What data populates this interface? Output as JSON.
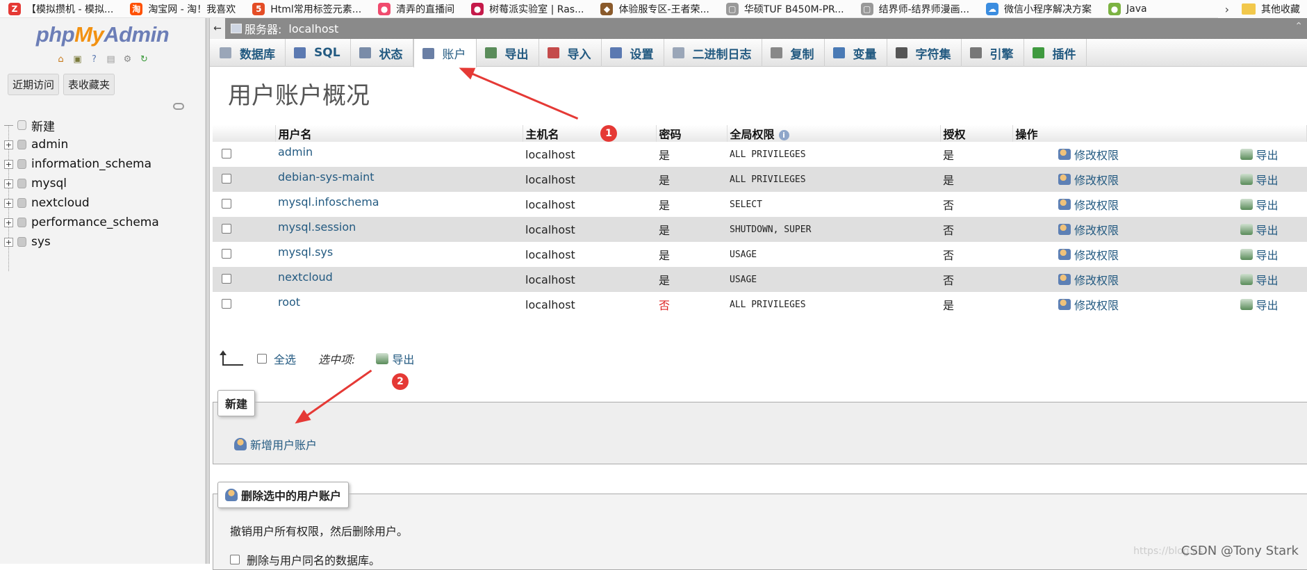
{
  "bookmarks": [
    {
      "label": "【模拟攒机 - 模拟...",
      "icon": "zol-icon",
      "color": "#e53935",
      "glyph": "Z"
    },
    {
      "label": "淘宝网 - 淘！我喜欢",
      "icon": "taobao-icon",
      "color": "#ff5000",
      "glyph": "淘"
    },
    {
      "label": "Html常用标签元素...",
      "icon": "html5-icon",
      "color": "#e44d26",
      "glyph": "5"
    },
    {
      "label": "清弄的直播间",
      "icon": "live-icon",
      "color": "#f04b6e",
      "glyph": "●"
    },
    {
      "label": "树莓派实验室 | Ras...",
      "icon": "raspberry-icon",
      "color": "#c51a4a",
      "glyph": "●"
    },
    {
      "label": "体验服专区-王者荣...",
      "icon": "game-icon",
      "color": "#8a5a2b",
      "glyph": "◆"
    },
    {
      "label": "华硕TUF B450M-PR...",
      "icon": "page-icon",
      "color": "#999999",
      "glyph": "▢"
    },
    {
      "label": "结界师-结界师漫画...",
      "icon": "page-icon",
      "color": "#999999",
      "glyph": "▢"
    },
    {
      "label": "微信小程序解决方案",
      "icon": "cloud-icon",
      "color": "#3b8de0",
      "glyph": "☁"
    },
    {
      "label": "Java",
      "icon": "java-icon",
      "color": "#7cb342",
      "glyph": "●"
    }
  ],
  "bookmarks_more": "其他收藏",
  "logo": {
    "php": "php",
    "my": "My",
    "admin": "Admin"
  },
  "nav_buttons": {
    "recent": "近期访问",
    "favorites": "表收藏夹"
  },
  "tree": {
    "new_label": "新建",
    "databases": [
      "admin",
      "information_schema",
      "mysql",
      "nextcloud",
      "performance_schema",
      "sys"
    ]
  },
  "server_bar": {
    "label": "服务器:",
    "server": "localhost"
  },
  "tabs": [
    {
      "label": "数据库",
      "icon": "database-icon",
      "color": "#9aa6b8"
    },
    {
      "label": "SQL",
      "icon": "sql-icon",
      "color": "#5b79b1"
    },
    {
      "label": "状态",
      "icon": "status-icon",
      "color": "#7a8ca8"
    },
    {
      "label": "账户",
      "icon": "accounts-icon",
      "color": "#6a7fa5",
      "active": true
    },
    {
      "label": "导出",
      "icon": "export-icon",
      "color": "#5a8c5a"
    },
    {
      "label": "导入",
      "icon": "import-icon",
      "color": "#c44a4a"
    },
    {
      "label": "设置",
      "icon": "wrench-icon",
      "color": "#5b79b1"
    },
    {
      "label": "二进制日志",
      "icon": "binlog-icon",
      "color": "#9aa6b8"
    },
    {
      "label": "复制",
      "icon": "replicate-icon",
      "color": "#888888"
    },
    {
      "label": "变量",
      "icon": "variables-icon",
      "color": "#4a7ab5"
    },
    {
      "label": "字符集",
      "icon": "charset-icon",
      "color": "#555555"
    },
    {
      "label": "引擎",
      "icon": "engine-icon",
      "color": "#777777"
    },
    {
      "label": "插件",
      "icon": "plugin-icon",
      "color": "#3f9a3f"
    }
  ],
  "page_title": "用户账户概况",
  "table": {
    "headers": {
      "username": "用户名",
      "host": "主机名",
      "password": "密码",
      "global_privs": "全局权限",
      "grant": "授权",
      "actions": "操作"
    },
    "rows": [
      {
        "user": "admin",
        "host": "localhost",
        "password": "是",
        "privs": "ALL PRIVILEGES",
        "grant": "是"
      },
      {
        "user": "debian-sys-maint",
        "host": "localhost",
        "password": "是",
        "privs": "ALL PRIVILEGES",
        "grant": "是"
      },
      {
        "user": "mysql.infoschema",
        "host": "localhost",
        "password": "是",
        "privs": "SELECT",
        "grant": "否"
      },
      {
        "user": "mysql.session",
        "host": "localhost",
        "password": "是",
        "privs": "SHUTDOWN, SUPER",
        "grant": "否"
      },
      {
        "user": "mysql.sys",
        "host": "localhost",
        "password": "是",
        "privs": "USAGE",
        "grant": "否"
      },
      {
        "user": "nextcloud",
        "host": "localhost",
        "password": "是",
        "privs": "USAGE",
        "grant": "否"
      },
      {
        "user": "root",
        "host": "localhost",
        "password": "否",
        "privs": "ALL PRIVILEGES",
        "grant": "是"
      }
    ],
    "edit_label": "修改权限",
    "export_label": "导出"
  },
  "bulk": {
    "select_all": "全选",
    "with_selected": "选中项:",
    "export": "导出"
  },
  "new_section": {
    "legend": "新建",
    "add_user": "新增用户账户"
  },
  "delete_section": {
    "legend": "删除选中的用户账户",
    "description": "撤销用户所有权限，然后删除用户。",
    "drop_db_label": "删除与用户同名的数据库。"
  },
  "annotations": {
    "badge1": "1",
    "badge2": "2"
  },
  "watermark": "CSDN @Tony Stark",
  "watermark_faint": "https://blog.cs",
  "colors": {
    "link": "#235a81",
    "annotation": "#e53935",
    "no_password": "#dd2222"
  }
}
